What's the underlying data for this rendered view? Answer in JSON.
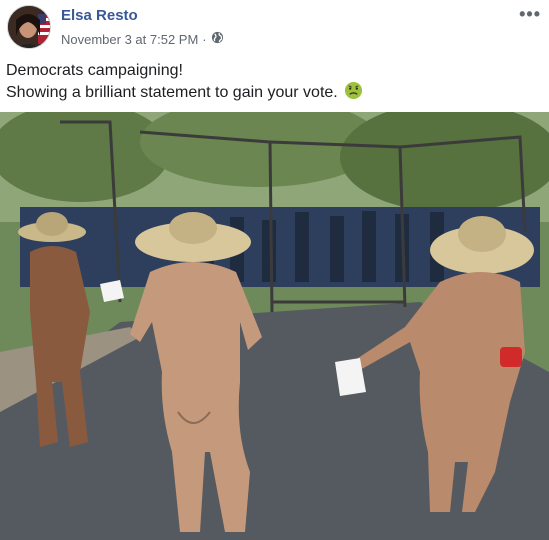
{
  "post": {
    "author": "Elsa Resto",
    "timestamp": "November 3 at 7:52 PM",
    "separator": "·",
    "privacy_icon": "globe-icon",
    "more_label": "•••",
    "text_line1": "Democrats campaigning!",
    "text_line2": "Showing a brilliant statement to gain your vote.",
    "emoji": "nauseated-face-emoji"
  },
  "colors": {
    "author": "#385898",
    "meta": "#616770",
    "text": "#1c1e21",
    "emoji": "#9ac23c"
  }
}
